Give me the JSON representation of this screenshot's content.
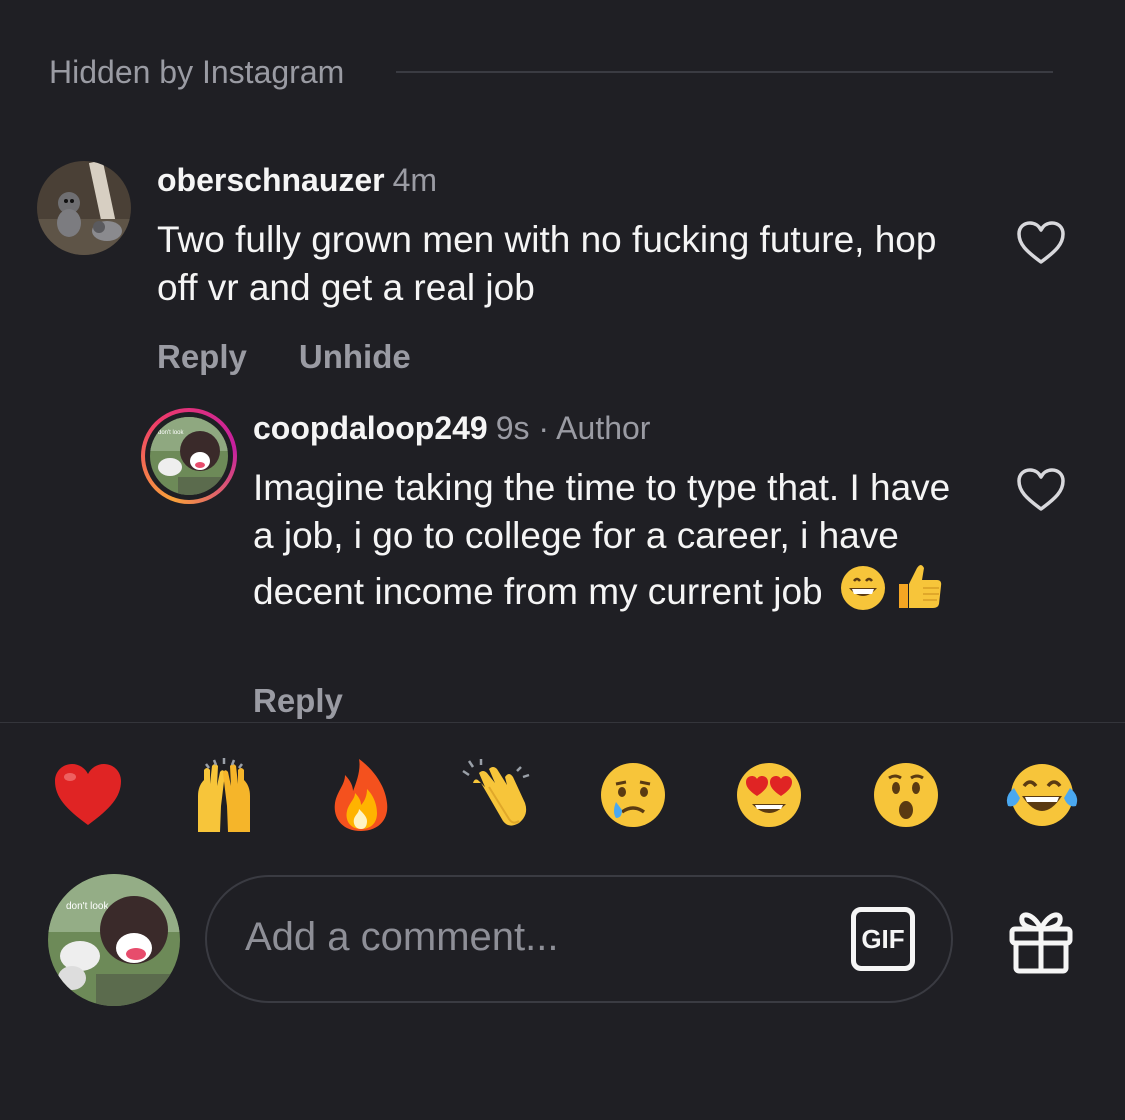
{
  "section": {
    "label": "Hidden by Instagram"
  },
  "comments": [
    {
      "username": "oberschnauzer",
      "time": "4m",
      "text": "Two fully grown men with no fucking future, hop off vr and get a real job",
      "actions": [
        "Reply",
        "Unhide"
      ]
    }
  ],
  "reply": {
    "username": "coopdaloop249",
    "meta": "9s · Author",
    "text": "Imagine taking the time to type that. I have a job, i go to college for a career, i have decent income from my current job",
    "emojis": [
      "grinning-face",
      "thumbs-up"
    ],
    "actions": [
      "Reply"
    ],
    "avatar_text": "don't look"
  },
  "reactions": [
    "heart",
    "raised-hands",
    "fire",
    "clapping-hands",
    "crying-face",
    "heart-eyes-face",
    "surprised-face",
    "tears-of-joy-face"
  ],
  "composer": {
    "placeholder": "Add a comment...",
    "gif_label": "GIF",
    "avatar_text": "don't look"
  },
  "colors": {
    "background": "#1f1f24",
    "secondary_text": "#9a9ba3",
    "story_ring_start": "#f9a13a",
    "story_ring_end": "#c51fa0"
  }
}
